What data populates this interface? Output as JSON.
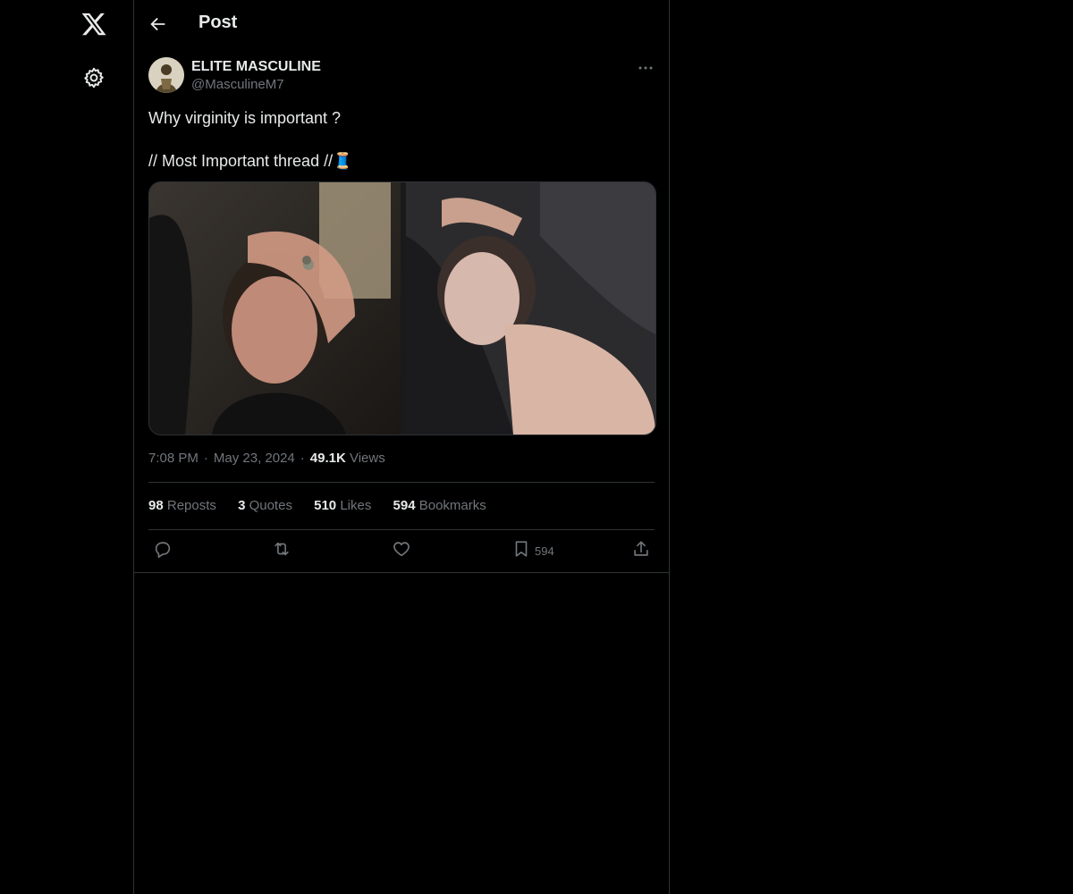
{
  "nav": {
    "logo_icon": "x-logo-icon",
    "settings_icon": "gear-icon"
  },
  "header": {
    "back_icon": "arrow-left-icon",
    "title": "Post"
  },
  "post": {
    "author": {
      "name": "ELITE MASCULINE",
      "handle": "@MasculineM7"
    },
    "text": "Why virginity is important ?\n\n// Most Important thread //🧵",
    "media": {
      "count": 2,
      "description_icon": "photo-grid"
    },
    "time": "7:08 PM",
    "date": "May 23, 2024",
    "views_count": "49.1K",
    "views_label": "Views",
    "separator": "·",
    "stats": [
      {
        "count": "98",
        "label": "Reposts"
      },
      {
        "count": "3",
        "label": "Quotes"
      },
      {
        "count": "510",
        "label": "Likes"
      },
      {
        "count": "594",
        "label": "Bookmarks"
      }
    ],
    "actions": {
      "reply_icon": "reply-icon",
      "repost_icon": "repost-icon",
      "like_icon": "heart-icon",
      "bookmark_icon": "bookmark-icon",
      "bookmark_count": "594",
      "share_icon": "share-icon"
    }
  },
  "colors": {
    "background": "#000000",
    "text_primary": "#e7e9ea",
    "text_secondary": "#71767b",
    "border": "#2f3336"
  }
}
